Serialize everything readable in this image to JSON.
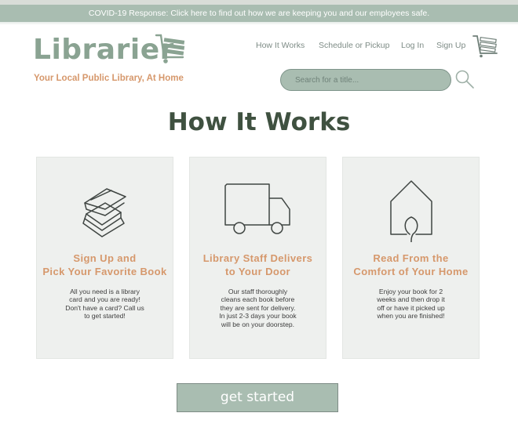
{
  "banner": {
    "text": "COVID-19 Response: Click here to find out how we are keeping you and our employees safe."
  },
  "header": {
    "logo": "Librarier",
    "tagline": "Your Local Public Library, At Home",
    "nav": [
      "How It Works",
      "Schedule or Pickup",
      "Log In",
      "Sign Up"
    ],
    "search_placeholder": "Search for a title..."
  },
  "main": {
    "title": "How It Works",
    "cards": [
      {
        "icon": "books-stack-icon",
        "title_lines": [
          "Sign Up and",
          "Pick Your Favorite Book"
        ],
        "body_lines": [
          "All you need is a library",
          "card and you are ready!",
          "Don't have a card? Call us",
          "to get started!"
        ]
      },
      {
        "icon": "delivery-truck-icon",
        "title_lines": [
          "Library Staff Delivers",
          "to Your Door"
        ],
        "body_lines": [
          "Our staff thoroughly",
          "cleans each book before",
          "they are sent for delivery.",
          "In just 2-3 days your book",
          "will be on your doorstep."
        ]
      },
      {
        "icon": "home-icon",
        "title_lines": [
          "Read From the",
          "Comfort of Your Home"
        ],
        "body_lines": [
          "Enjoy your book for 2",
          "weeks and then drop it",
          "off or have it picked up",
          "when you are finished!"
        ]
      }
    ],
    "cta_label": "get started"
  },
  "colors": {
    "accent_green": "#a9bdb1",
    "logo_green": "#8aa392",
    "accent_orange": "#d6986c",
    "title_dark": "#3f5140",
    "card_bg": "#eef0ee"
  }
}
